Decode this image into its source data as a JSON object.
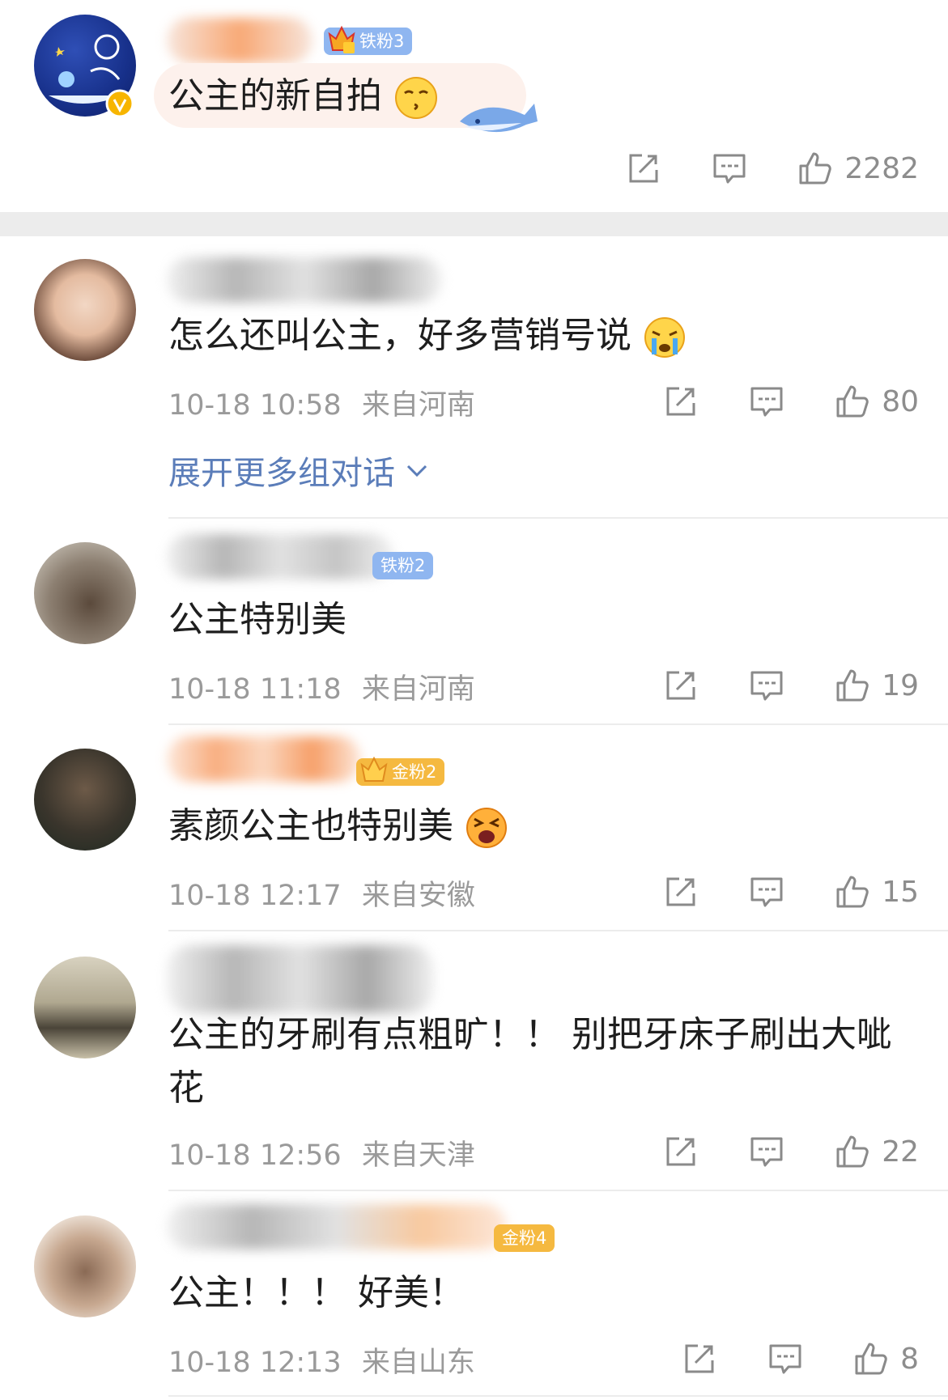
{
  "post": {
    "badge": "铁粉3",
    "text": "公主的新自拍",
    "like_count": "2282"
  },
  "expand_conversation": "展开更多组对话",
  "comments": [
    {
      "badge": "",
      "text": "怎么还叫公主，好多营销号说",
      "time": "10-18 10:58",
      "location": "来自河南",
      "likes": "80"
    },
    {
      "badge": "铁粉2",
      "text": "公主特别美",
      "time": "10-18 11:18",
      "location": "来自河南",
      "likes": "19"
    },
    {
      "badge": "金粉2",
      "text": "素颜公主也特别美",
      "time": "10-18 12:17",
      "location": "来自安徽",
      "likes": "15"
    },
    {
      "badge": "",
      "text_line1": "公主的牙刷有点粗旷！！ 别把牙床子刷出大呲",
      "text_line2": "花",
      "time": "10-18 12:56",
      "location": "来自天津",
      "likes": "22"
    },
    {
      "badge": "金粉4",
      "text": "公主！！！ 好美！",
      "time": "10-18 12:13",
      "location": "来自山东",
      "likes": "8"
    }
  ],
  "colors": {
    "iron_fan_badge": "#8fb6f0",
    "gold_fan_badge": "#f5b940",
    "link_blue": "#5b7db9",
    "meta_gray": "#9a9a9a",
    "section_gray": "#ececec"
  },
  "icons": [
    "share-icon",
    "comment-icon",
    "like-icon",
    "verified-icon",
    "chevron-down-icon"
  ]
}
